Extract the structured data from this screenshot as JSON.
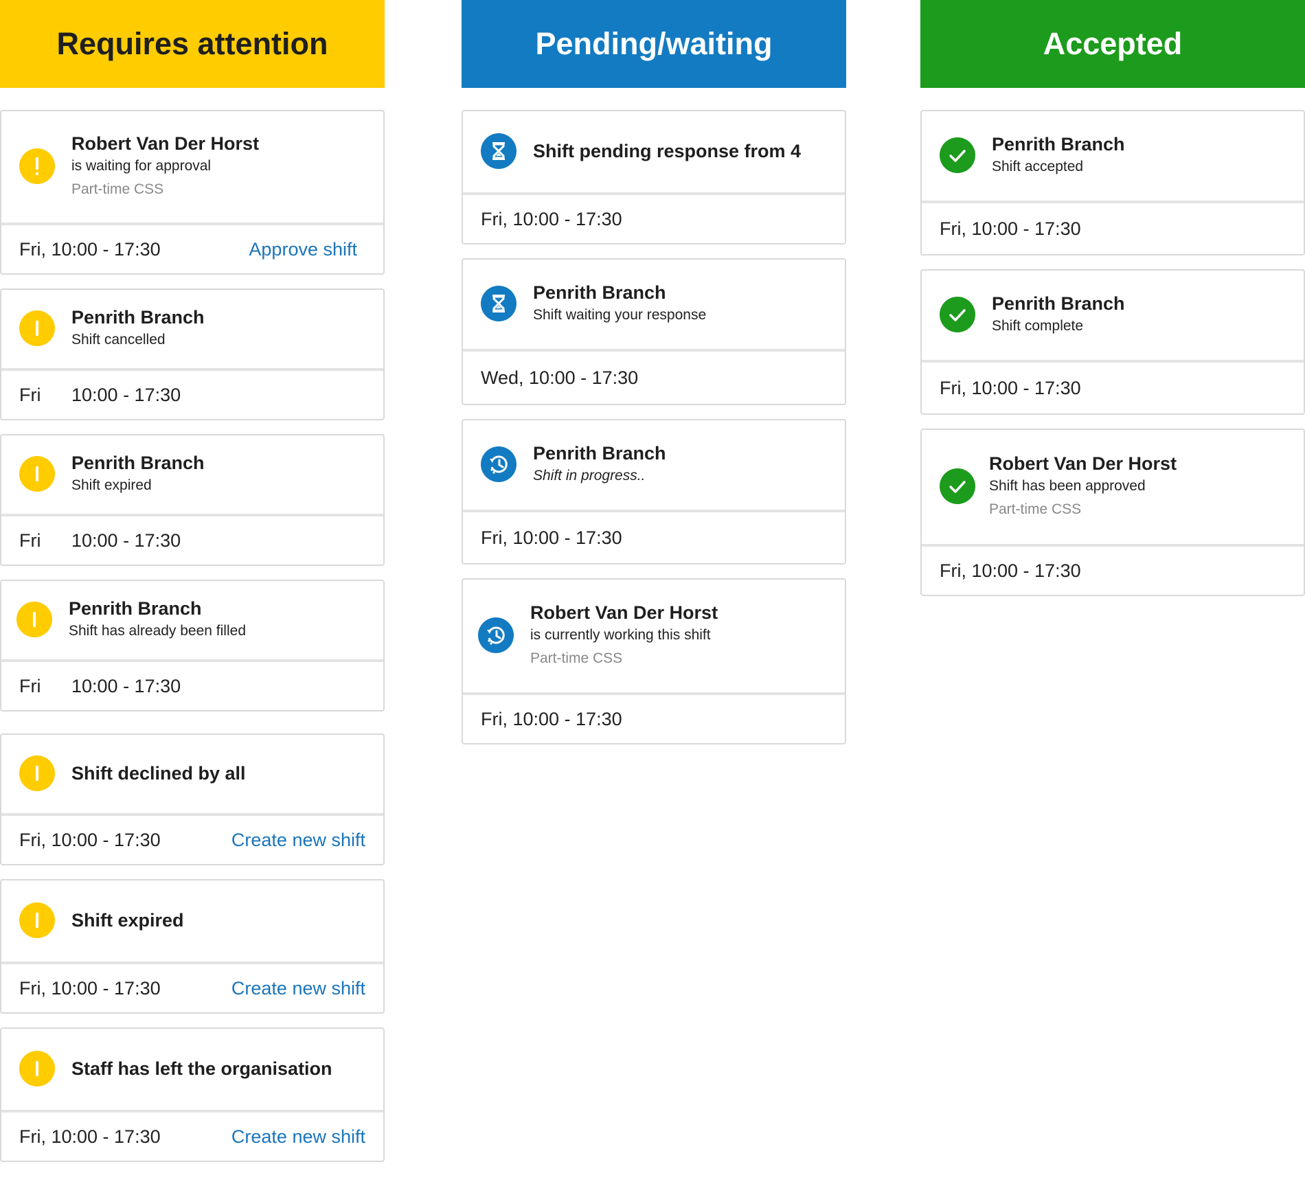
{
  "colors": {
    "attention": "#ffcc00",
    "pending": "#137bc2",
    "accepted": "#1c9b1c",
    "link": "#1a75bb"
  },
  "columns": {
    "attention": {
      "header": "Requires attention",
      "cards": [
        {
          "title": "Robert Van Der Horst",
          "subtitle": "is waiting for approval",
          "role": "Part-time CSS",
          "time": "Fri, 10:00 - 17:30",
          "action": "Approve shift",
          "icon": "exclamation-icon"
        },
        {
          "title": "Penrith Branch",
          "subtitle": "Shift cancelled",
          "day": "Fri",
          "time": "10:00 - 17:30",
          "icon": "exclamation-icon"
        },
        {
          "title": "Penrith Branch",
          "subtitle": "Shift expired",
          "day": "Fri",
          "time": "10:00 - 17:30",
          "icon": "exclamation-icon"
        },
        {
          "title": "Penrith Branch",
          "subtitle": "Shift has already been filled",
          "day": "Fri",
          "time": "10:00 - 17:30",
          "icon": "exclamation-icon"
        },
        {
          "title": "Shift declined by all",
          "time": "Fri, 10:00 - 17:30",
          "action": "Create new shift",
          "icon": "exclamation-icon"
        },
        {
          "title": "Shift expired",
          "time": "Fri, 10:00 - 17:30",
          "action": "Create new shift",
          "icon": "exclamation-icon"
        },
        {
          "title": "Staff has left the organisation",
          "time": "Fri, 10:00 - 17:30",
          "action": "Create new shift",
          "icon": "exclamation-icon"
        }
      ]
    },
    "pending": {
      "header": "Pending/waiting",
      "cards": [
        {
          "title": "Shift pending response from 4",
          "time": "Fri, 10:00 - 17:30",
          "icon": "hourglass-icon"
        },
        {
          "title": "Penrith Branch",
          "subtitle": "Shift waiting your response",
          "time": "Wed, 10:00 - 17:30",
          "icon": "hourglass-icon"
        },
        {
          "title": "Penrith Branch",
          "subtitle": "Shift in progress..",
          "time": "Fri, 10:00 - 17:30",
          "icon": "clock-progress-icon"
        },
        {
          "title": "Robert Van Der Horst",
          "subtitle": "is currently working this shift",
          "role": "Part-time CSS",
          "time": "Fri, 10:00 - 17:30",
          "icon": "clock-progress-icon"
        }
      ]
    },
    "accepted": {
      "header": "Accepted",
      "cards": [
        {
          "title": "Penrith Branch",
          "subtitle": "Shift accepted",
          "time": "Fri, 10:00 - 17:30",
          "icon": "check-icon"
        },
        {
          "title": "Penrith Branch",
          "subtitle": "Shift complete",
          "time": "Fri, 10:00 - 17:30",
          "icon": "check-icon"
        },
        {
          "title": "Robert Van Der Horst",
          "subtitle": "Shift has been approved",
          "role": "Part-time CSS",
          "time": "Fri, 10:00 - 17:30",
          "icon": "check-icon"
        }
      ]
    }
  }
}
